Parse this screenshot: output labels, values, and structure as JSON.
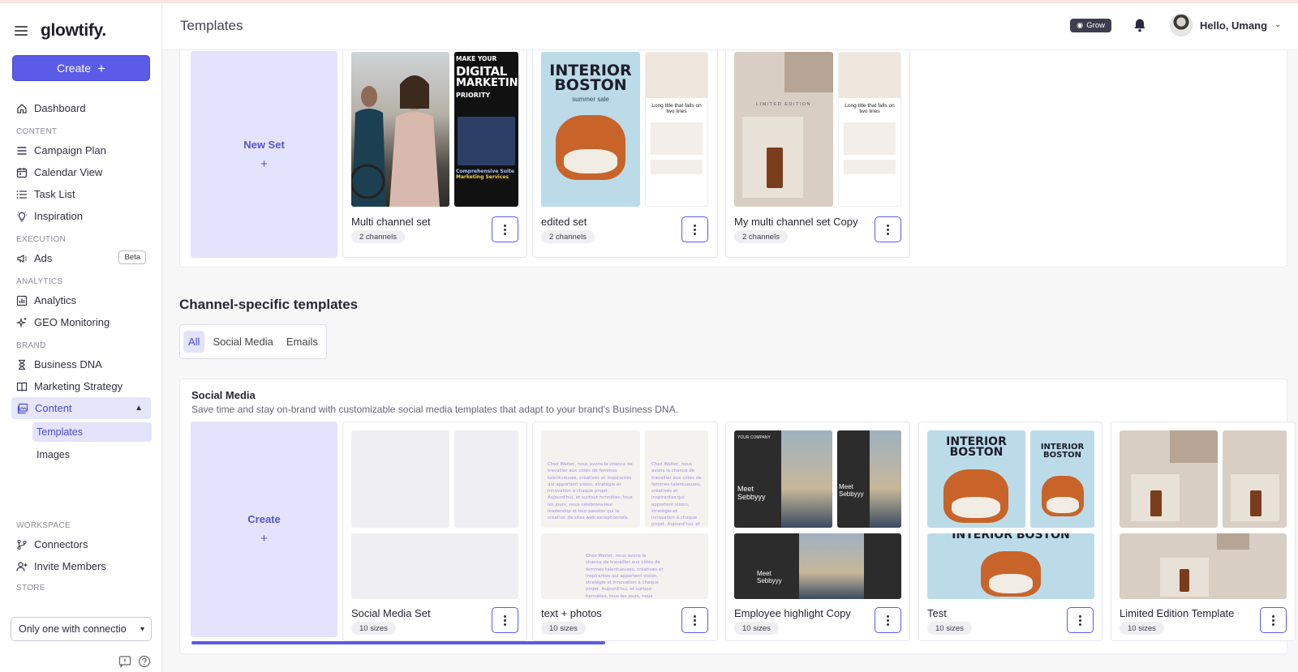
{
  "app": {
    "logo": "glowtify.",
    "create_label": "Create",
    "create_icon": "+",
    "page_title": "Templates",
    "grow_label": "Grow",
    "greeting": "Hello, Umang"
  },
  "sidebar": {
    "dashboard": "Dashboard",
    "sections": {
      "content": "CONTENT",
      "execution": "EXECUTION",
      "analytics": "ANALYTICS",
      "brand": "BRAND",
      "workspace": "WORKSPACE",
      "store": "STORE"
    },
    "content_items": [
      "Campaign Plan",
      "Calendar View",
      "Task List",
      "Inspiration"
    ],
    "execution_items": [
      "Ads"
    ],
    "beta_badge": "Beta",
    "analytics_items": [
      "Analytics",
      "GEO Monitoring"
    ],
    "brand_items": [
      "Business DNA",
      "Marketing Strategy",
      "Content"
    ],
    "content_sub": [
      "Templates",
      "Images"
    ],
    "workspace_items": [
      "Connectors",
      "Invite Members"
    ],
    "store_value": "Only one with connectio"
  },
  "multi_channel": {
    "new_set_label": "New Set",
    "plus": "+",
    "cards": [
      {
        "title": "Multi channel set",
        "badge": "2 channels"
      },
      {
        "title": "edited set",
        "badge": "2 channels"
      },
      {
        "title": "My multi channel set Copy",
        "badge": "2 channels"
      }
    ],
    "thumb_text": {
      "digital_1": "MAKE YOUR",
      "digital_2": "DIGITAL",
      "digital_3": "MARKETING",
      "digital_4": "PRIORITY",
      "digital_5": "Comprehensive Suite",
      "digital_6": "Marketing Services",
      "interior": "INTERIOR BOSTON",
      "summer": "summer sale",
      "long_title": "Long title that falls on two lines",
      "limited": "LIMITED EDITION"
    }
  },
  "channel_specific": {
    "title": "Channel-specific templates",
    "tabs": [
      "All",
      "Social Media",
      "Emails"
    ],
    "social": {
      "title": "Social Media",
      "description": "Save time and stay on-brand with customizable social media templates that adapt to your brand's Business DNA.",
      "create_label": "Create",
      "plus": "+",
      "cards": [
        {
          "title": "Social Media Set",
          "badge": "10 sizes"
        },
        {
          "title": "text + photos",
          "badge": "10 sizes"
        },
        {
          "title": "Employee highlight Copy",
          "badge": "10 sizes"
        },
        {
          "title": "Test",
          "badge": "10 sizes"
        },
        {
          "title": "Limited Edition Template",
          "badge": "10 sizes"
        }
      ],
      "french_text": "Chez Walter, nous avons la chance de travailler aux côtés de femmes talentueuses, créatives et inspirantes qui apportent vision, stratégie et innovation à chaque projet. Aujourd'hui, et surtout honnêtes, tous les jours, nous célébrons leur leadership et leur passion qui la création de sites web exceptionnels.",
      "meet": "Meet Sebbyyy",
      "your_company": "YOUR COMPANY"
    }
  },
  "colors": {
    "accent": "#5b5be8",
    "accent_light": "#e4e3fd",
    "sidebar_active": "#e6e6fb"
  },
  "icons": {
    "menu": "hamburger-icon",
    "bell": "bell-icon",
    "kebab": "kebab-icon"
  }
}
